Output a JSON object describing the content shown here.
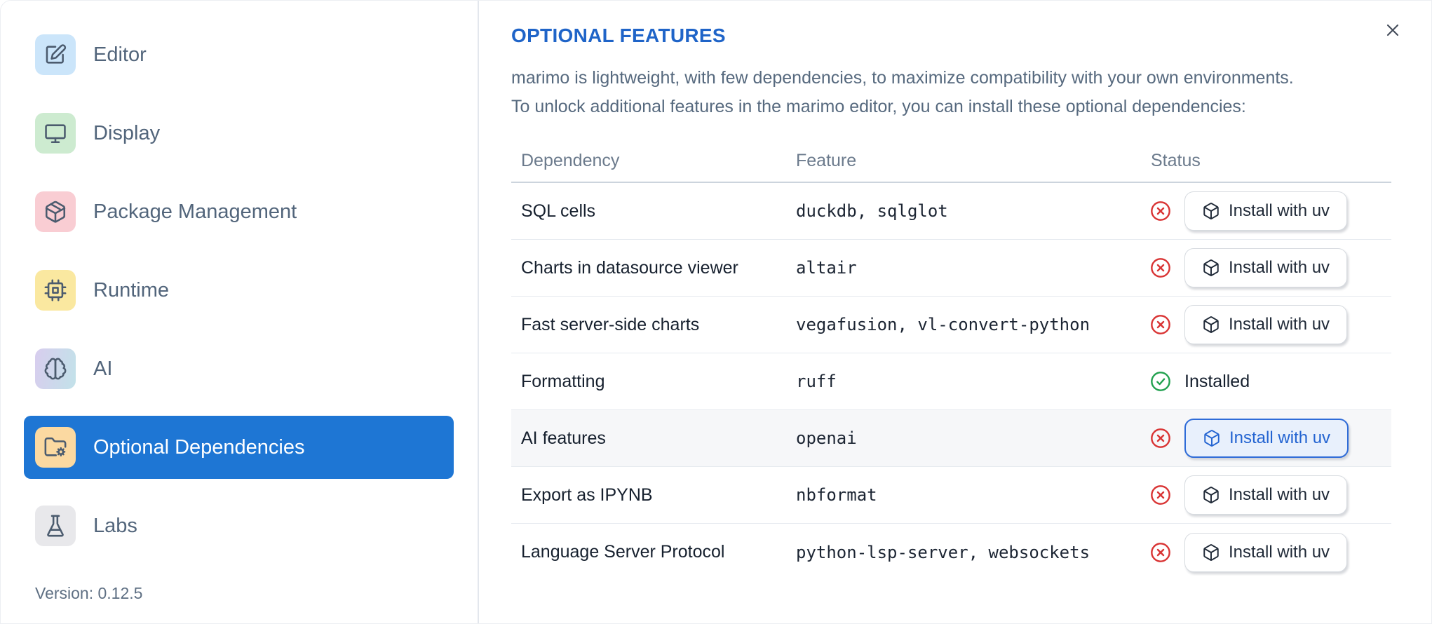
{
  "sidebar": {
    "items": [
      {
        "label": "Editor",
        "icon": "edit-icon",
        "tile": [
          "#cbe5fa"
        ]
      },
      {
        "label": "Display",
        "icon": "monitor-icon",
        "tile": [
          "#cdebd0"
        ]
      },
      {
        "label": "Package Management",
        "icon": "package-icon",
        "tile": [
          "#f9cdd3"
        ]
      },
      {
        "label": "Runtime",
        "icon": "cpu-icon",
        "tile": [
          "#fae8a0"
        ]
      },
      {
        "label": "AI",
        "icon": "brain-icon",
        "tile": [
          "#d8cdee",
          "#c2e2e9"
        ]
      },
      {
        "label": "Optional Dependencies",
        "icon": "folder-gear-icon",
        "tile": [
          "#fbd9a1"
        ],
        "selected": true
      },
      {
        "label": "Labs",
        "icon": "flask-icon",
        "tile": [
          "#e8e8eb"
        ]
      }
    ],
    "version_label": "Version: 0.12.5"
  },
  "panel": {
    "title": "OPTIONAL FEATURES",
    "description_lines": [
      "marimo is lightweight, with few dependencies, to maximize compatibility with your own environments.",
      "To unlock additional features in the marimo editor, you can install these optional dependencies:"
    ],
    "table": {
      "headers": [
        "Dependency",
        "Feature",
        "Status"
      ],
      "rows": [
        {
          "dependency": "SQL cells",
          "feature": "duckdb, sqlglot",
          "status": "not-installed",
          "action_label": "Install with uv"
        },
        {
          "dependency": "Charts in datasource viewer",
          "feature": "altair",
          "status": "not-installed",
          "action_label": "Install with uv"
        },
        {
          "dependency": "Fast server-side charts",
          "feature": "vegafusion, vl-convert-python",
          "status": "not-installed",
          "action_label": "Install with uv"
        },
        {
          "dependency": "Formatting",
          "feature": "ruff",
          "status": "installed",
          "status_label": "Installed"
        },
        {
          "dependency": "AI features",
          "feature": "openai",
          "status": "not-installed",
          "action_label": "Install with uv",
          "highlighted": true
        },
        {
          "dependency": "Export as IPYNB",
          "feature": "nbformat",
          "status": "not-installed",
          "action_label": "Install with uv"
        },
        {
          "dependency": "Language Server Protocol",
          "feature": "python-lsp-server, websockets",
          "status": "not-installed",
          "action_label": "Install with uv"
        }
      ]
    }
  },
  "colors": {
    "accent": "#1e76d4",
    "title_blue": "#1f64c8",
    "installed_green": "#22a14f",
    "not_installed_red": "#d93434",
    "hover_button_border": "#2f6cd8",
    "hover_button_bg": "#e8f0fc",
    "hover_button_text": "#2263d1"
  }
}
